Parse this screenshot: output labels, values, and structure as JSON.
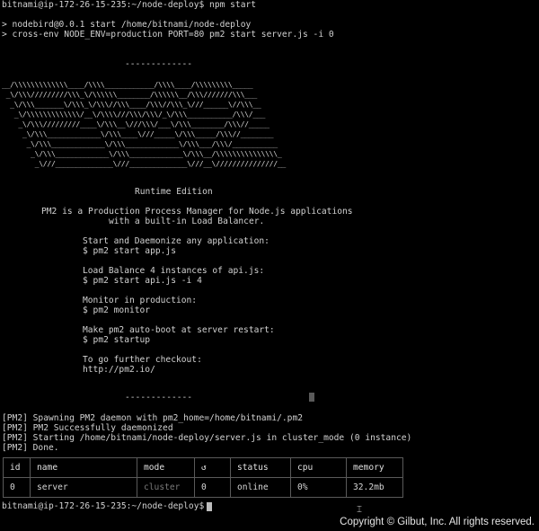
{
  "terminal": {
    "prompt_line": "bitnami@ip-172-26-15-235:~/node-deploy$ npm start",
    "npm_line1": "> nodebird@0.0.1 start /home/bitnami/node-deploy",
    "npm_line2": "> cross-env NODE_ENV=production PORT=80 pm2 start server.js -i 0",
    "separator_top": "-------------",
    "ascii_art": "__/\\\\\\\\\\\\\\\\\\\\\\\\\\____/\\\\\\\\____________/\\\\\\\\____/\\\\\\\\\\\\\\\\\\_____\n _\\/\\\\\\/////////\\\\\\_\\/\\\\\\\\\\\\________/\\\\\\\\\\\\__/\\\\\\///////\\\\\\___\n  _\\/\\\\\\_______\\/\\\\\\_\\/\\\\\\//\\\\\\____/\\\\\\//\\\\\\_\\///______\\//\\\\\\__\n   _\\/\\\\\\\\\\\\\\\\\\\\\\\\\\/__\\/\\\\\\\\///\\\\\\/\\\\\\/_\\/\\\\\\___________/\\\\\\/___\n    _\\/\\\\\\/////////____\\/\\\\\\__\\///\\\\\\/___\\/\\\\\\________/\\\\\\//_____\n     _\\/\\\\\\_____________\\/\\\\\\____\\///_____\\/\\\\\\_____/\\\\\\//________\n      _\\/\\\\\\_____________\\/\\\\\\_____________\\/\\\\\\___/\\\\\\/___________\n       _\\/\\\\\\_____________\\/\\\\\\_____________\\/\\\\\\__/\\\\\\\\\\\\\\\\\\\\\\\\\\\\\\_\n        _\\///______________\\///______________\\///__\\///////////////__",
    "edition": "Runtime Edition",
    "tagline1": "PM2 is a Production Process Manager for Node.js applications",
    "tagline2": "with a built-in Load Balancer.",
    "help1_title": "Start and Daemonize any application:",
    "help1_cmd": "$ pm2 start app.js",
    "help2_title": "Load Balance 4 instances of api.js:",
    "help2_cmd": "$ pm2 start api.js -i 4",
    "help3_title": "Monitor in production:",
    "help3_cmd": "$ pm2 monitor",
    "help4_title": "Make pm2 auto-boot at server restart:",
    "help4_cmd": "$ pm2 startup",
    "help5_title": "To go further checkout:",
    "help5_url": "http://pm2.io/",
    "separator_bottom": "-------------",
    "log1": "[PM2] Spawning PM2 daemon with pm2_home=/home/bitnami/.pm2",
    "log2": "[PM2] PM2 Successfully daemonized",
    "log3": "[PM2] Starting /home/bitnami/node-deploy/server.js in cluster_mode (0 instance)",
    "log4": "[PM2] Done.",
    "final_prompt": "bitnami@ip-172-26-15-235:~/node-deploy$"
  },
  "process_table": {
    "headers": [
      "id",
      "name",
      "mode",
      "↺",
      "status",
      "cpu",
      "memory"
    ],
    "rows": [
      [
        "0",
        "server",
        "cluster",
        "0",
        "online",
        "0%",
        "32.2mb"
      ]
    ]
  },
  "footer": {
    "copyright": "Copyright © Gilbut, Inc. All rights reserved."
  }
}
